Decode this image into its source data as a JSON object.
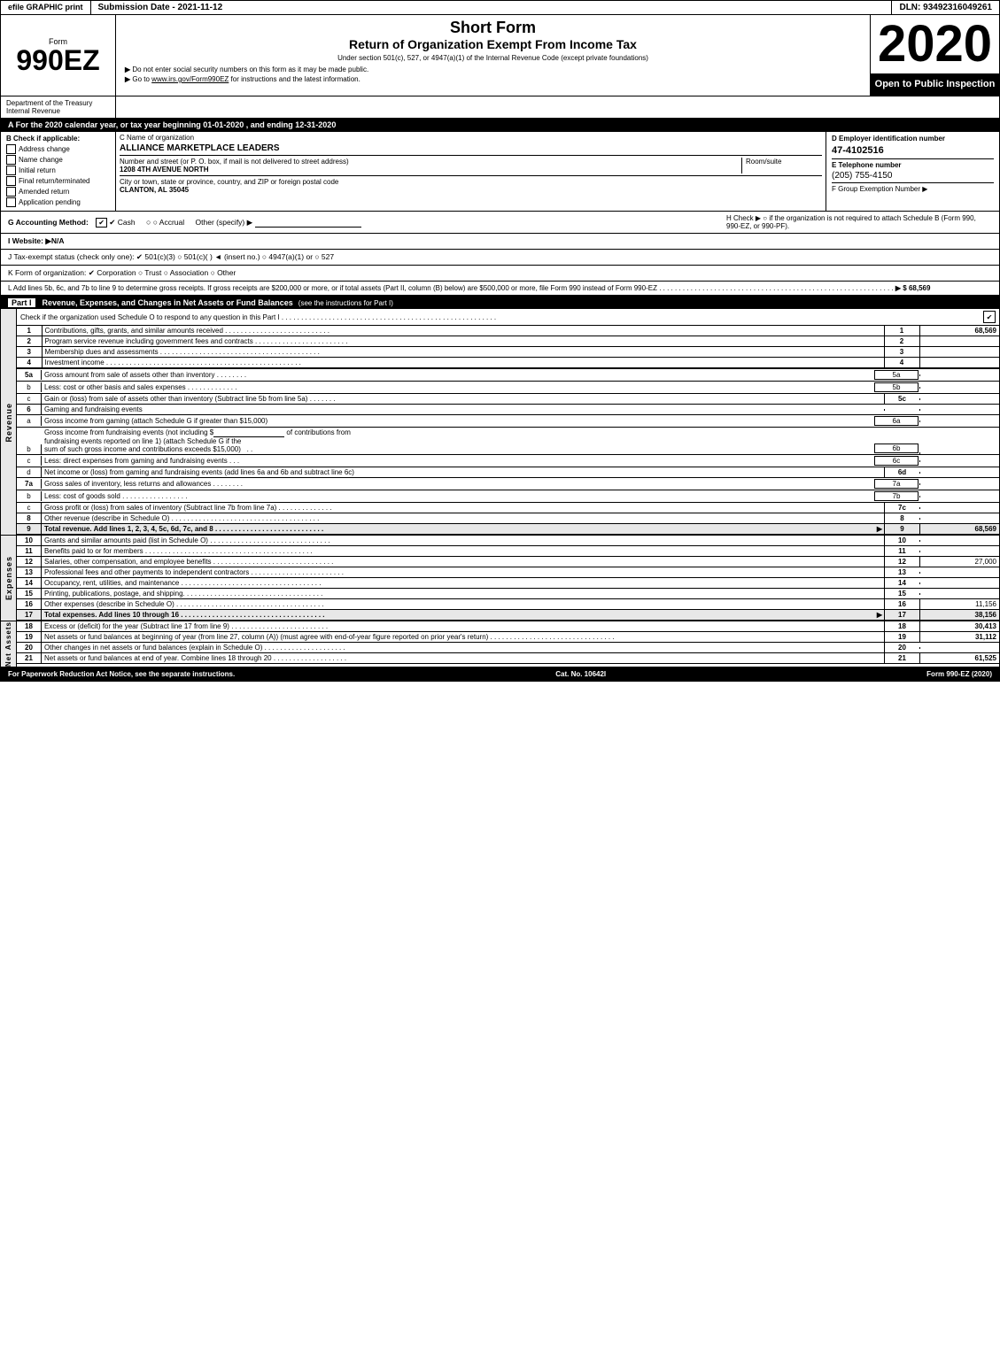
{
  "topBar": {
    "left": "efile GRAPHIC print",
    "mid": "Submission Date - 2021-11-12",
    "right": "DLN: 93492316049261"
  },
  "header": {
    "formLabel": "Form",
    "formNumber": "990EZ",
    "formSub": "",
    "shortFormTitle": "Short Form",
    "returnTitle": "Return of Organization Exempt From Income Tax",
    "underSection": "Under section 501(c), 527, or 4947(a)(1) of the Internal Revenue Code (except private foundations)",
    "year": "2020",
    "openInspection": "Open to Public Inspection"
  },
  "notices": {
    "dept": "Department of the Treasury Internal Revenue",
    "notice1": "▶ Do not enter social security numbers on this form as it may be made public.",
    "notice2": "▶ Go to www.irs.gov/Form990EZ for instructions and the latest information.",
    "notice2Link": "www.irs.gov/Form990EZ"
  },
  "taxYear": {
    "text": "A For the 2020 calendar year, or tax year beginning 01-01-2020 , and ending 12-31-2020"
  },
  "checkApplicable": {
    "label": "B Check if applicable:",
    "items": [
      {
        "id": "address-change",
        "label": "Address change",
        "checked": false
      },
      {
        "id": "name-change",
        "label": "Name change",
        "checked": false
      },
      {
        "id": "initial-return",
        "label": "Initial return",
        "checked": false
      },
      {
        "id": "final-return",
        "label": "Final return/terminated",
        "checked": false
      },
      {
        "id": "amended-return",
        "label": "Amended return",
        "checked": false
      },
      {
        "id": "application-pending",
        "label": "Application pending",
        "checked": false
      }
    ]
  },
  "orgInfo": {
    "nameLabel": "C Name of organization",
    "nameValue": "ALLIANCE MARKETPLACE LEADERS",
    "addressLabel": "Number and street (or P. O. box, if mail is not delivered to street address)",
    "addressValue": "1208 4TH AVENUE NORTH",
    "roomLabel": "Room/suite",
    "roomValue": "",
    "cityLabel": "City or town, state or province, country, and ZIP or foreign postal code",
    "cityValue": "CLANTON, AL  35045"
  },
  "employerInfo": {
    "dLabel": "D Employer identification number",
    "ein": "47-4102516",
    "eLabel": "E Telephone number",
    "telephone": "(205) 755-4150",
    "fLabel": "F Group Exemption Number",
    "groupNum": "▶"
  },
  "accounting": {
    "gLabel": "G Accounting Method:",
    "cashLabel": "✔ Cash",
    "accrualLabel": "○ Accrual",
    "otherLabel": "Other (specify) ▶",
    "hLabel": "H Check ▶ ○ if the organization is not required to attach Schedule B (Form 990, 990-EZ, or 990-PF)."
  },
  "website": {
    "iLabel": "I Website: ▶N/A"
  },
  "taxStatus": {
    "jLabel": "J Tax-exempt status (check only one): ✔ 501(c)(3) ○ 501(c)(  ) ◄ (insert no.) ○ 4947(a)(1) or ○ 527"
  },
  "formOrg": {
    "kLabel": "K Form of organization: ✔ Corporation  ○ Trust  ○ Association  ○ Other"
  },
  "grossReceipts": {
    "lText": "L Add lines 5b, 6c, and 7b to line 9 to determine gross receipts. If gross receipts are $200,000 or more, or if total assets (Part II, column (B) below) are $500,000 or more, file Form 990 instead of Form 990-EZ",
    "dots": ". . . . . . . . . . . . . . . . . . . . . . . . . . . . . . . . . . . . . . . . . . . . . . . . . . . .",
    "arrow": "▶ $",
    "value": "68,569"
  },
  "partI": {
    "label": "Part I",
    "title": "Revenue, Expenses, and Changes in Net Assets or Fund Balances",
    "subtitle": "(see the instructions for Part I)",
    "checkText": "Check if the organization used Schedule O to respond to any question in this Part I",
    "checkDots": ". . . . . . . . . . . . . . . . . . . . . . . . . . . . . . . . . . . . . . . . . . . . . . . . . . . . . . .",
    "checkBox": "✔",
    "lines": [
      {
        "num": "1",
        "desc": "Contributions, gifts, grants, and similar amounts received . . . . . . . . . . . . . . . . . . . . . . . . . . .",
        "boxNum": "1",
        "value": "68,569"
      },
      {
        "num": "2",
        "desc": "Program service revenue including government fees and contracts . . . . . . . . . . . . . . . . . . . . . . . .",
        "boxNum": "2",
        "value": ""
      },
      {
        "num": "3",
        "desc": "Membership dues and assessments . . . . . . . . . . . . . . . . . . . . . . . . . . . . . . . . . . . . . . . . .",
        "boxNum": "3",
        "value": ""
      },
      {
        "num": "4",
        "desc": "Investment income . . . . . . . . . . . . . . . . . . . . . . . . . . . . . . . . . . . . . . . . . . . . . . . . . .",
        "boxNum": "4",
        "value": ""
      }
    ],
    "line5": {
      "num": "5a",
      "desc": "Gross amount from sale of assets other than inventory . . . . . . . .",
      "innerBox": "5a",
      "value": ""
    },
    "line5b": {
      "num": "b",
      "desc": "Less: cost or other basis and sales expenses . . . . . . . . . . . . .",
      "innerBox": "5b",
      "value": ""
    },
    "line5c": {
      "num": "c",
      "desc": "Gain or (loss) from sale of assets other than inventory (Subtract line 5b from line 5a) . . . . . . .",
      "boxNum": "5c",
      "value": ""
    },
    "line6": {
      "num": "6",
      "desc": "Gaming and fundraising events"
    },
    "line6a": {
      "num": "a",
      "desc": "Gross income from gaming (attach Schedule G if greater than $15,000)",
      "innerBox": "6a",
      "value": ""
    },
    "line6b": {
      "num": "b",
      "desc1": "Gross income from fundraising events (not including $",
      "desc2": "of contributions from",
      "desc3": "fundraising events reported on line 1) (attach Schedule G if the",
      "desc4": "sum of such gross income and contributions exceeds $15,000)",
      "dots": ". .",
      "innerBox": "6b",
      "value": ""
    },
    "line6c": {
      "num": "c",
      "desc": "Less: direct expenses from gaming and fundraising events",
      "dots": ". . .",
      "innerBox": "6c",
      "value": ""
    },
    "line6d": {
      "num": "d",
      "desc": "Net income or (loss) from gaming and fundraising events (add lines 6a and 6b and subtract line 6c)",
      "boxNum": "6d",
      "value": ""
    },
    "line7a": {
      "num": "7a",
      "desc": "Gross sales of inventory, less returns and allowances . . . . . . . .",
      "innerBox": "7a",
      "value": ""
    },
    "line7b": {
      "num": "b",
      "desc": "Less: cost of goods sold",
      "dots": ". . . . . . . . . . . . . . . . .",
      "innerBox": "7b",
      "value": ""
    },
    "line7c": {
      "num": "c",
      "desc": "Gross profit or (loss) from sales of inventory (Subtract line 7b from line 7a) . . . . . . . . . . . . . .",
      "boxNum": "7c",
      "value": ""
    },
    "line8": {
      "num": "8",
      "desc": "Other revenue (describe in Schedule O) . . . . . . . . . . . . . . . . . . . . . . . . . . . . . . . . . . . . . .",
      "boxNum": "8",
      "value": ""
    },
    "line9": {
      "num": "9",
      "desc": "Total revenue. Add lines 1, 2, 3, 4, 5c, 6d, 7c, and 8 . . . . . . . . . . . . . . . . . . . . . . . . . . . .",
      "arrow": "▶",
      "boxNum": "9",
      "value": "68,569"
    }
  },
  "expenses": {
    "label": "Expenses",
    "lines": [
      {
        "num": "10",
        "desc": "Grants and similar amounts paid (list in Schedule O) . . . . . . . . . . . . . . . . . . . . . . . . . . . . . . .",
        "boxNum": "10",
        "value": ""
      },
      {
        "num": "11",
        "desc": "Benefits paid to or for members . . . . . . . . . . . . . . . . . . . . . . . . . . . . . . . . . . . . . . . . . . .",
        "boxNum": "11",
        "value": ""
      },
      {
        "num": "12",
        "desc": "Salaries, other compensation, and employee benefits . . . . . . . . . . . . . . . . . . . . . . . . . . . . . . .",
        "boxNum": "12",
        "value": "27,000"
      },
      {
        "num": "13",
        "desc": "Professional fees and other payments to independent contractors . . . . . . . . . . . . . . . . . . . . . . . .",
        "boxNum": "13",
        "value": ""
      },
      {
        "num": "14",
        "desc": "Occupancy, rent, utilities, and maintenance . . . . . . . . . . . . . . . . . . . . . . . . . . . . . . . . . . . .",
        "boxNum": "14",
        "value": ""
      },
      {
        "num": "15",
        "desc": "Printing, publications, postage, and shipping. . . . . . . . . . . . . . . . . . . . . . . . . . . . . . . . . . . .",
        "boxNum": "15",
        "value": ""
      },
      {
        "num": "16",
        "desc": "Other expenses (describe in Schedule O) . . . . . . . . . . . . . . . . . . . . . . . . . . . . . . . . . . . . . .",
        "boxNum": "16",
        "value": "11,156"
      },
      {
        "num": "17",
        "desc": "Total expenses. Add lines 10 through 16 . . . . . . . . . . . . . . . . . . . . . . . . . . . . . . . . . . . . .",
        "arrow": "▶",
        "boxNum": "17",
        "value": "38,156",
        "bold": true
      }
    ]
  },
  "netAssets": {
    "label": "Net Assets",
    "lines": [
      {
        "num": "18",
        "desc": "Excess or (deficit) for the year (Subtract line 17 from line 9) . . . . . . . . . . . . . . . . . . . . . . . . .",
        "boxNum": "18",
        "value": "30,413"
      },
      {
        "num": "19",
        "desc": "Net assets or fund balances at beginning of year (from line 27, column (A)) (must agree with end-of-year figure reported on prior year's return) . . . . . . . . . . . . . . . . . . . . . . . . . . . . . . . .",
        "boxNum": "19",
        "value": "31,112"
      },
      {
        "num": "20",
        "desc": "Other changes in net assets or fund balances (explain in Schedule O) . . . . . . . . . . . . . . . . . . . . .",
        "boxNum": "20",
        "value": ""
      },
      {
        "num": "21",
        "desc": "Net assets or fund balances at end of year. Combine lines 18 through 20 . . . . . . . . . . . . . . . . . . .",
        "boxNum": "21",
        "value": "61,525"
      }
    ]
  },
  "footer": {
    "left": "For Paperwork Reduction Act Notice, see the separate instructions.",
    "mid": "Cat. No. 10642I",
    "right": "Form 990-EZ (2020)"
  }
}
